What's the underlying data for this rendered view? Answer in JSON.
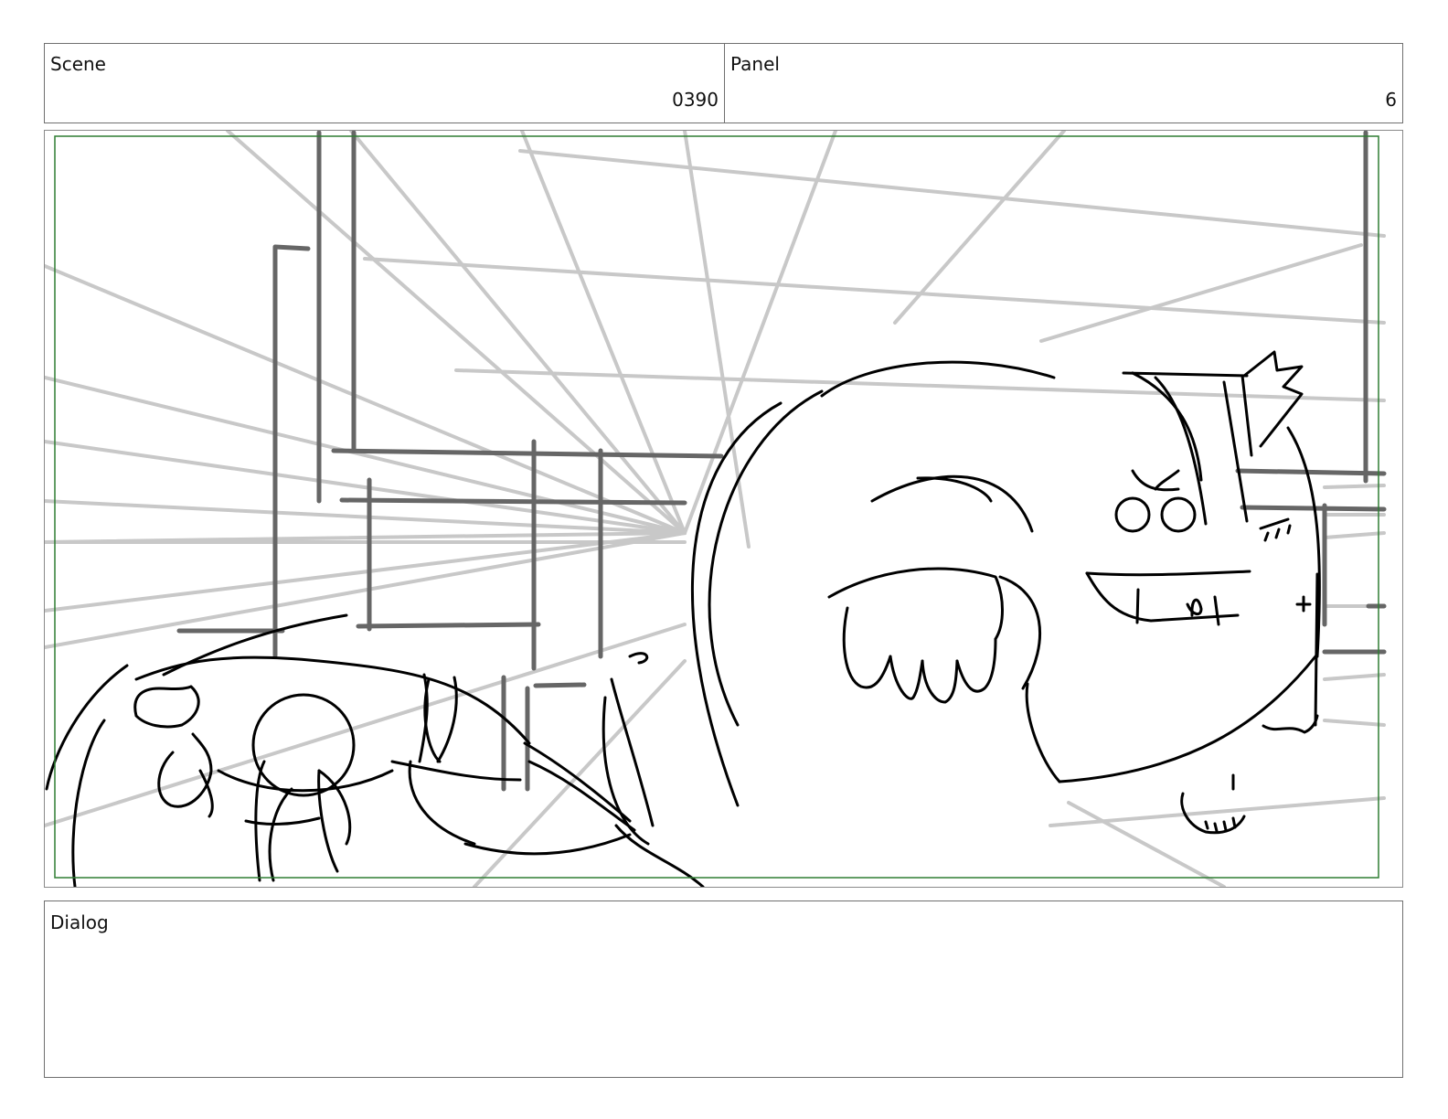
{
  "header": {
    "scene_label": "Scene",
    "scene_value": "0390",
    "panel_label": "Panel",
    "panel_value": "6"
  },
  "frame": {
    "safe_area_color": "#2f7d32",
    "background_color": "#ffffff"
  },
  "dialog": {
    "label": "Dialog"
  },
  "colors": {
    "border": "#6f6f6f",
    "perspective_lines": "#c8c8c8",
    "structure_lines": "#666666",
    "character_lines": "#000000"
  }
}
